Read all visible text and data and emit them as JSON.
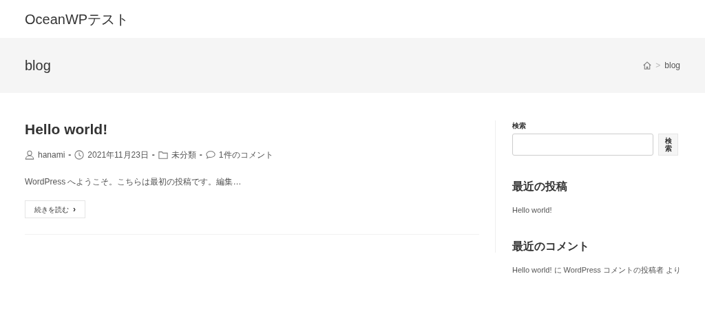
{
  "site_title": "OceanWPテスト",
  "page_header": {
    "title": "blog",
    "breadcrumb": {
      "separator": ">",
      "current": "blog"
    }
  },
  "post": {
    "title": "Hello world!",
    "meta": [
      {
        "kind": "author",
        "text": "hanami"
      },
      {
        "kind": "date",
        "text": "2021年11月23日"
      },
      {
        "kind": "category",
        "text": "未分類"
      },
      {
        "kind": "comments",
        "text": "1件のコメント"
      }
    ],
    "meta_separator": "-",
    "excerpt": "WordPress へようこそ。こちらは最初の投稿です。編集…",
    "read_more": "続きを読む",
    "read_more_arrow": "›"
  },
  "sidebar": {
    "search": {
      "label": "検索",
      "button": "検索"
    },
    "recent_posts": {
      "title": "最近の投稿",
      "items": [
        "Hello world!"
      ]
    },
    "recent_comments": {
      "title": "最近のコメント",
      "items": [
        "Hello world! に WordPress コメントの投稿者 より"
      ]
    }
  }
}
